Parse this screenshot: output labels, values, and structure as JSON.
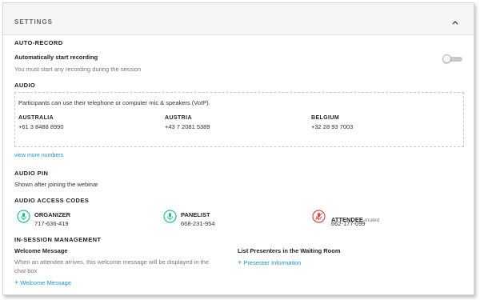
{
  "header": {
    "title": "SETTINGS"
  },
  "auto_record": {
    "section_label": "AUTO-RECORD",
    "title": "Automatically start recording",
    "description": "You must start any recording during the session",
    "toggle_on": false
  },
  "audio": {
    "section_label": "AUDIO",
    "description": "Participants can use their telephone or computer mic & speakers (VoIP).",
    "numbers": [
      {
        "country": "AUSTRALIA",
        "phone": "+61 3 8488 8990"
      },
      {
        "country": "AUSTRIA",
        "phone": "+43 7 2081 5389"
      },
      {
        "country": "BELGIUM",
        "phone": "+32 28 93 7003"
      }
    ],
    "more_link": "view more numbers"
  },
  "audio_pin": {
    "section_label": "AUDIO PIN",
    "description": "Shown after joining the webinar"
  },
  "access_codes": {
    "section_label": "AUDIO ACCESS CODES",
    "codes": [
      {
        "role": "ORGANIZER",
        "suffix": "",
        "code": "717-636-419",
        "color": "#1fbf9f",
        "muted": false
      },
      {
        "role": "PANELIST",
        "suffix": "",
        "code": "668-231-954",
        "color": "#1fbf9f",
        "muted": false
      },
      {
        "role": "ATTENDEE",
        "suffix": "-muted",
        "code": "662-177-099",
        "color": "#e04646",
        "muted": true
      }
    ]
  },
  "in_session": {
    "section_label": "IN-SESSION MANAGEMENT",
    "welcome": {
      "title": "Welcome Message",
      "description_line1": "When an attendee arrives, this welcome message will be displayed in the",
      "description_line2": "chat box",
      "add_link": "Welcome Message"
    },
    "presenters": {
      "title": "List Presenters in the Waiting Room",
      "add_link": "Presenter Information"
    }
  },
  "colors": {
    "link": "#1e96cc",
    "accent_green": "#1fbf9f",
    "accent_red": "#e04646"
  }
}
